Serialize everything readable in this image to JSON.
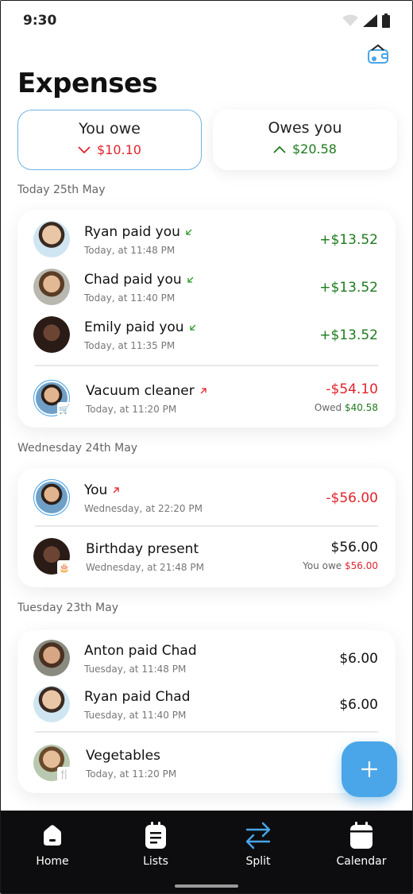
{
  "status": {
    "time": "9:30"
  },
  "page_title": "Expenses",
  "tabs": {
    "you_owe": {
      "label": "You owe",
      "amount": "$10.10"
    },
    "owes_you": {
      "label": "Owes you",
      "amount": "$20.58"
    }
  },
  "days": [
    {
      "label": "Today 25th May",
      "items": [
        {
          "name": "Ryan paid you",
          "time": "Today, at 11:48 PM",
          "value": "+$13.52"
        },
        {
          "name": "Chad paid you",
          "time": "Today, at 11:40 PM",
          "value": "+$13.52"
        },
        {
          "name": "Emily paid you",
          "time": "Today, at 11:35 PM",
          "value": "+$13.52"
        },
        {
          "name": "Vacuum cleaner",
          "time": "Today, at 11:20 PM",
          "value": "-$54.10",
          "owed_label": "Owed",
          "owed_value": "$40.58"
        }
      ]
    },
    {
      "label": "Wednesday 24th May",
      "items": [
        {
          "name": "You",
          "time": "Wednesday, at 22:20 PM",
          "value": "-$56.00"
        },
        {
          "name": "Birthday present",
          "time": "Wednesday, at 21:48 PM",
          "value": "$56.00",
          "owed_label": "You owe",
          "owed_value": "$56.00"
        }
      ]
    },
    {
      "label": "Tuesday 23th May",
      "items": [
        {
          "name": "Anton paid Chad",
          "time": "Tuesday, at 11:48 PM",
          "value": "$6.00"
        },
        {
          "name": "Ryan paid Chad",
          "time": "Tuesday, at 11:40 PM",
          "value": "$6.00"
        },
        {
          "name": "Vegetables",
          "time": "Today, at 11:20 PM"
        }
      ]
    }
  ],
  "fab": {
    "icon": "plus-icon",
    "label": "+"
  },
  "nav": [
    {
      "label": "Home",
      "icon": "home-icon"
    },
    {
      "label": "Lists",
      "icon": "list-icon"
    },
    {
      "label": "Split",
      "icon": "split-arrows-icon",
      "active": true
    },
    {
      "label": "Calendar",
      "icon": "calendar-icon"
    }
  ],
  "colors": {
    "accent": "#4aa6e8",
    "positive": "#1f7a1f",
    "negative": "#e0242c",
    "navbar": "#0d0d0f"
  }
}
